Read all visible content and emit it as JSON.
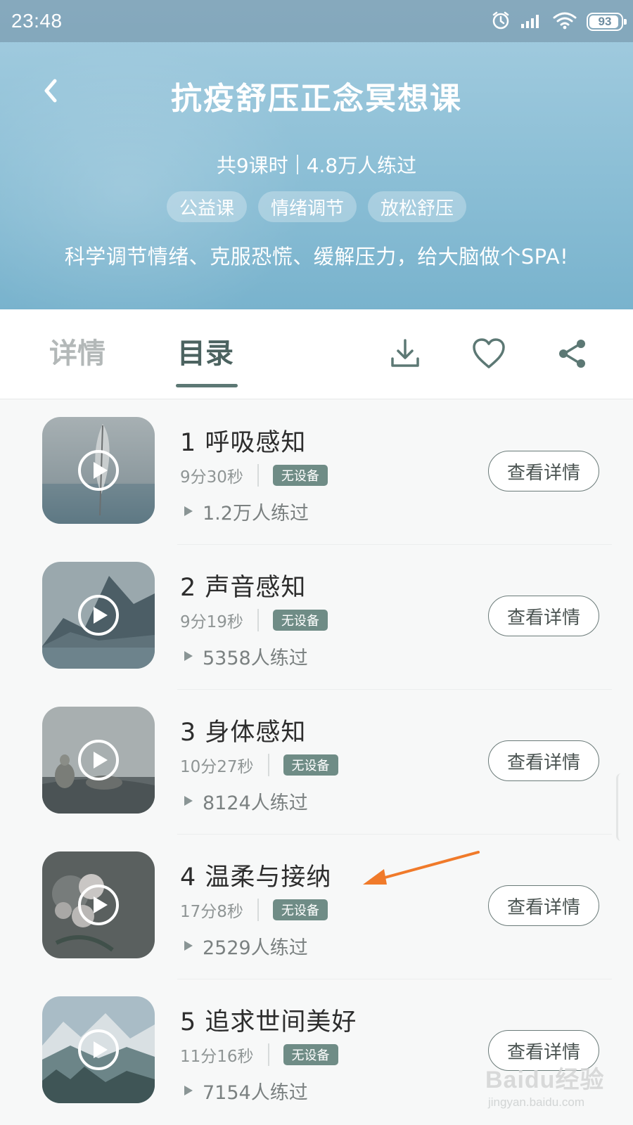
{
  "status_bar": {
    "time": "23:48",
    "battery": "93",
    "battery_level": 0.93
  },
  "header": {
    "title": "抗疫舒压正念冥想课",
    "lessons": "共9课时",
    "practiced": "4.8万人练过",
    "tags": [
      "公益课",
      "情绪调节",
      "放松舒压"
    ],
    "subtitle": "科学调节情绪、克服恐慌、缓解压力，给大脑做个SPA!"
  },
  "tabs": [
    {
      "label": "详情",
      "active": false
    },
    {
      "label": "目录",
      "active": true
    }
  ],
  "toolbar": {
    "icons": [
      "download-icon",
      "heart-icon",
      "share-icon"
    ]
  },
  "lessons": [
    {
      "title": "1 呼吸感知",
      "duration": "9分30秒",
      "badge": "无设备",
      "plays": "1.2万人练过",
      "button": "查看详情",
      "thumb": "feather"
    },
    {
      "title": "2 声音感知",
      "duration": "9分19秒",
      "badge": "无设备",
      "plays": "5358人练过",
      "button": "查看详情",
      "thumb": "mountain-lake"
    },
    {
      "title": "3 身体感知",
      "duration": "10分27秒",
      "badge": "无设备",
      "plays": "8124人练过",
      "button": "查看详情",
      "thumb": "stones"
    },
    {
      "title": "4 温柔与接纳",
      "duration": "17分8秒",
      "badge": "无设备",
      "plays": "2529人练过",
      "button": "查看详情",
      "thumb": "roses"
    },
    {
      "title": "5 追求世间美好",
      "duration": "11分16秒",
      "badge": "无设备",
      "plays": "7154人练过",
      "button": "查看详情",
      "thumb": "snow-mountains"
    }
  ],
  "annotation": {
    "arrow_color": "#f07a2a"
  },
  "watermark": {
    "brand": "Baidu经验",
    "url": "jingyan.baidu.com"
  },
  "colors": {
    "accent": "#5c7874",
    "badge": "#6f8c86",
    "header_blue": "#8cbfd6"
  }
}
